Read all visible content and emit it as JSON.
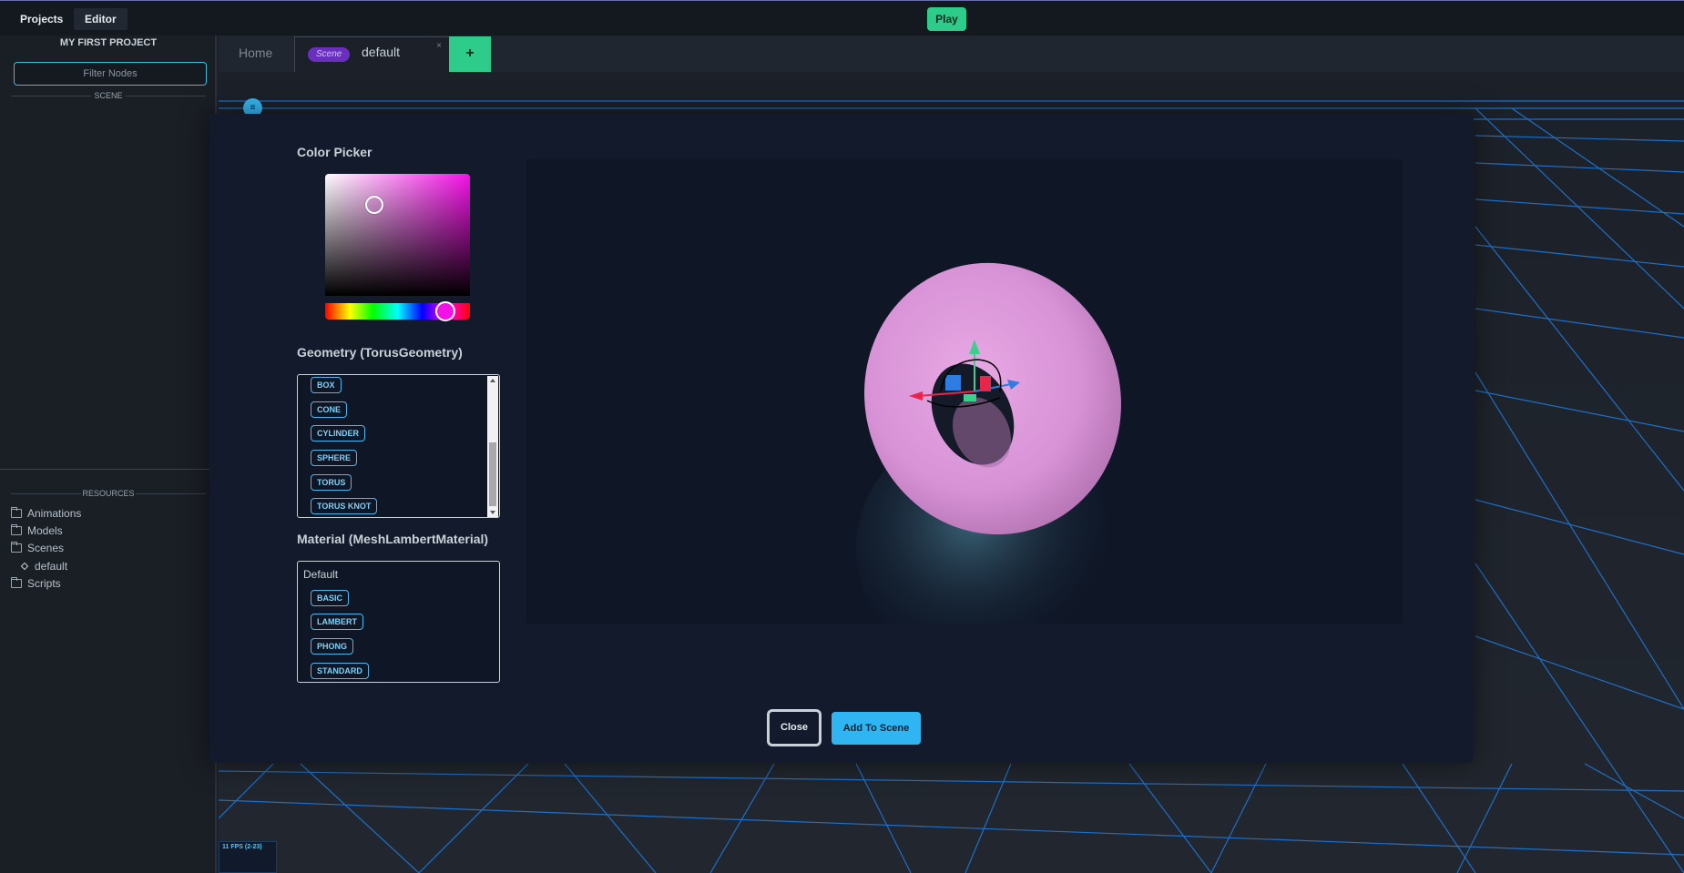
{
  "topbar": {
    "projects_label": "Projects",
    "editor_label": "Editor",
    "play_label": "Play"
  },
  "sidebar": {
    "project_title": "MY FIRST PROJECT",
    "filter_placeholder": "Filter Nodes",
    "scene_section": "SCENE",
    "resources_section": "RESOURCES",
    "resources": [
      {
        "label": "Animations",
        "icon": "folder-icon"
      },
      {
        "label": "Models",
        "icon": "folder-icon"
      },
      {
        "label": "Scenes",
        "icon": "folder-open-icon"
      },
      {
        "label": "default",
        "icon": "diamond-icon"
      },
      {
        "label": "Scripts",
        "icon": "folder-icon"
      }
    ]
  },
  "tabs": {
    "home_label": "Home",
    "scene_badge": "Scene",
    "scene_name": "default",
    "close_glyph": "×",
    "add_glyph": "+"
  },
  "viewport": {
    "fps_text": "11 FPS (2-23)",
    "menu_glyph": "≡"
  },
  "modal": {
    "color_picker_label": "Color Picker",
    "selected_color": "#d792d6",
    "hue_color": "#f312e6",
    "geometry_label": "Geometry (TorusGeometry)",
    "geometry_options": [
      "BOX",
      "CONE",
      "CYLINDER",
      "SPHERE",
      "TORUS",
      "TORUS KNOT"
    ],
    "material_label": "Material (MeshLambertMaterial)",
    "material_default": "Default",
    "material_options": [
      "BASIC",
      "LAMBERT",
      "PHONG",
      "STANDARD"
    ],
    "close_label": "Close",
    "add_label": "Add To Scene"
  }
}
